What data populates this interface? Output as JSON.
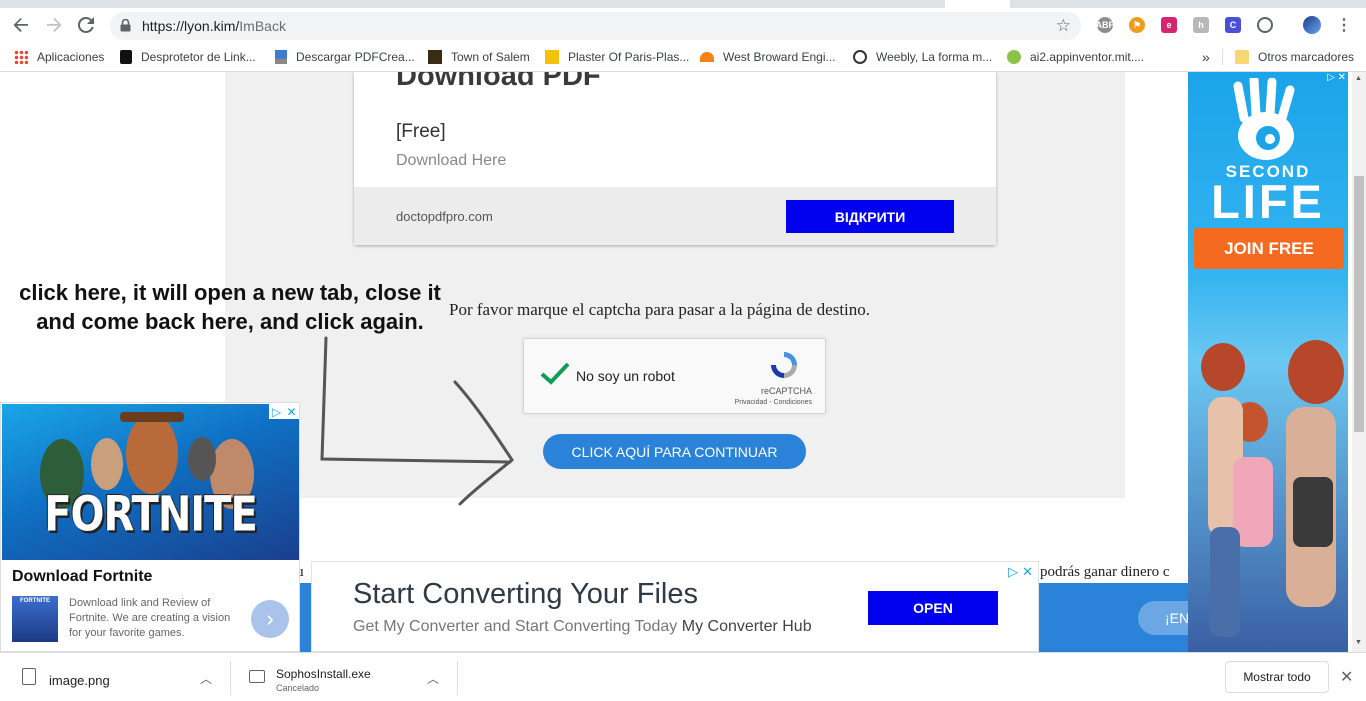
{
  "browser": {
    "url_host": "https://lyon.kim/",
    "url_path": "ImBack",
    "bookmarks": [
      {
        "label": "Aplicaciones",
        "icon": "apps-grid-icon"
      },
      {
        "label": "Desprotetor de Link...",
        "icon": "unlock-icon"
      },
      {
        "label": "Descargar PDFCrea...",
        "icon": "download-icon"
      },
      {
        "label": "Town of Salem",
        "icon": "salem-icon"
      },
      {
        "label": "Plaster Of Paris-Plas...",
        "icon": "plaster-icon"
      },
      {
        "label": "West Broward Engi...",
        "icon": "moodle-icon"
      },
      {
        "label": "Weebly, La forma m...",
        "icon": "weebly-icon"
      },
      {
        "label": "ai2.appinventor.mit....",
        "icon": "appinventor-icon"
      }
    ],
    "bookmarks_overflow": "»",
    "other_bookmarks": "Otros marcadores"
  },
  "top_ad": {
    "title": "Download PDF",
    "price": "[Free]",
    "subtitle": "Download Here",
    "domain": "doctopdfpro.com",
    "button": "ВІДКРИТИ"
  },
  "instruction": {
    "line1": "click here, it will open a new tab, close it",
    "line2": "and come back here, and click again."
  },
  "captcha_prompt": "Por favor marque el captcha para pasar a la página de destino.",
  "recaptcha": {
    "label": "No soy un robot",
    "brand": "reCAPTCHA",
    "links": "Privacidad - Condiciones",
    "checked": true
  },
  "continue_button": "CLICK AQUÍ PARA CONTINUAR",
  "below_text": "podrás ganar dinero c",
  "left_fragment": "tu",
  "en_button": "¡EN",
  "fortnite_ad": {
    "banner_text": "FORTNITE",
    "headline": "Download Fortnite",
    "thumb_text": "FORTNITE",
    "description": "Download link and Review of Fortnite. We are creating a vision for your favorite games."
  },
  "converter_ad": {
    "headline": "Start Converting Your Files",
    "subtitle": "Get My Converter and Start Converting Today",
    "advertiser": "My Converter Hub",
    "button": "OPEN"
  },
  "second_life_ad": {
    "second": "SECOND",
    "life": "LIFE",
    "button": "JOIN FREE"
  },
  "downloads": [
    {
      "name": "image.png",
      "status": ""
    },
    {
      "name": "SophosInstall.exe",
      "status": "Cancelado"
    }
  ],
  "show_all": "Mostrar todo"
}
